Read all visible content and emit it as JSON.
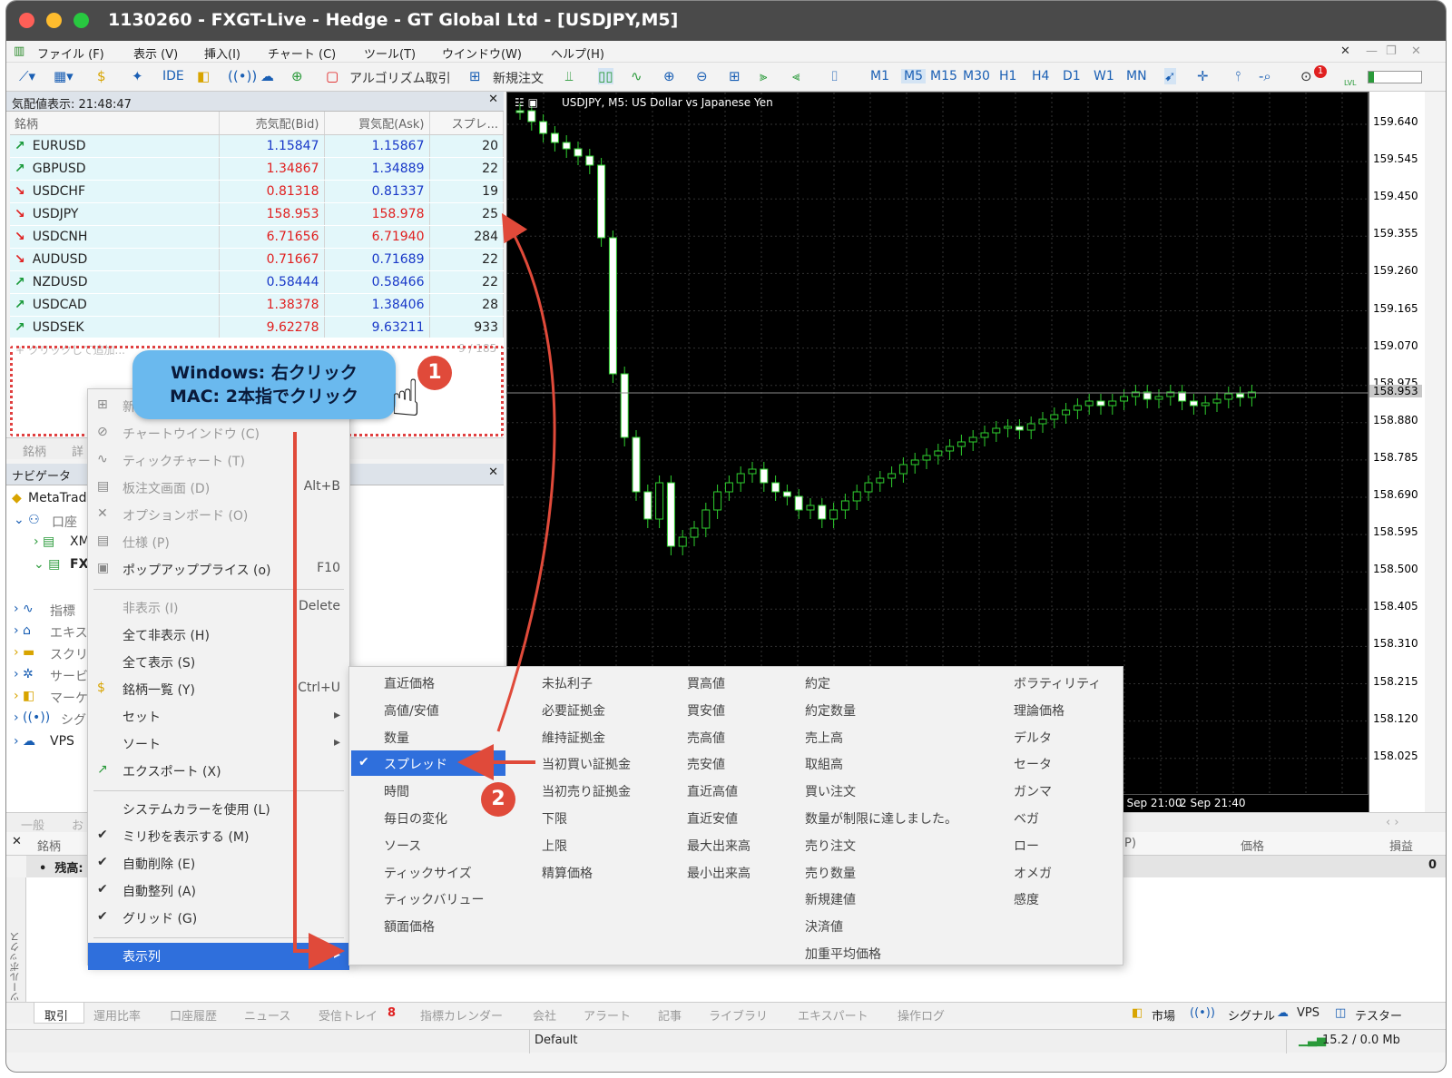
{
  "window": {
    "title": "1130260 - FXGT-Live - Hedge - GT Global Ltd - [USDJPY,M5]"
  },
  "menu": [
    "ファイル (F)",
    "表示 (V)",
    "挿入(I)",
    "チャート (C)",
    "ツール(T)",
    "ウインドウ(W)",
    "ヘルプ(H)"
  ],
  "toolbar": {
    "ide": "IDE",
    "algo": "アルゴリズム取引",
    "neworder": "新規注文",
    "timeframes": [
      "M1",
      "M5",
      "M15",
      "M30",
      "H1",
      "H4",
      "D1",
      "W1",
      "MN"
    ],
    "notif_count": "1",
    "lvl": "LVL"
  },
  "market_watch": {
    "title": "気配値表示: 21:48:47",
    "columns": [
      "銘柄",
      "売気配(Bid)",
      "買気配(Ask)",
      "スプレ..."
    ],
    "rows": [
      {
        "symbol": "EURUSD",
        "bid": "1.15847",
        "ask": "1.15867",
        "spread": "20",
        "dir": "up",
        "bidc": "blue",
        "askc": "blue"
      },
      {
        "symbol": "GBPUSD",
        "bid": "1.34867",
        "ask": "1.34889",
        "spread": "22",
        "dir": "up",
        "bidc": "red",
        "askc": "blue"
      },
      {
        "symbol": "USDCHF",
        "bid": "0.81318",
        "ask": "0.81337",
        "spread": "19",
        "dir": "down",
        "bidc": "red",
        "askc": "blue"
      },
      {
        "symbol": "USDJPY",
        "bid": "158.953",
        "ask": "158.978",
        "spread": "25",
        "dir": "down",
        "bidc": "red",
        "askc": "red"
      },
      {
        "symbol": "USDCNH",
        "bid": "6.71656",
        "ask": "6.71940",
        "spread": "284",
        "dir": "down",
        "bidc": "red",
        "askc": "red"
      },
      {
        "symbol": "AUDUSD",
        "bid": "0.71667",
        "ask": "0.71689",
        "spread": "22",
        "dir": "down",
        "bidc": "red",
        "askc": "blue"
      },
      {
        "symbol": "NZDUSD",
        "bid": "0.58444",
        "ask": "0.58466",
        "spread": "22",
        "dir": "up",
        "bidc": "blue",
        "askc": "blue"
      },
      {
        "symbol": "USDCAD",
        "bid": "1.38378",
        "ask": "1.38406",
        "spread": "28",
        "dir": "up",
        "bidc": "red",
        "askc": "blue"
      },
      {
        "symbol": "USDSEK",
        "bid": "9.62278",
        "ask": "9.63211",
        "spread": "933",
        "dir": "up",
        "bidc": "red",
        "askc": "blue"
      }
    ],
    "add_hint": "+ クリックして追加...",
    "count": "9 / 185",
    "tabs": [
      "銘柄",
      "詳"
    ]
  },
  "callout": {
    "line1": "Windows: 右クリック",
    "line2": "MAC: 2本指でクリック",
    "step1": "1",
    "step2": "2"
  },
  "navigator": {
    "title": "ナビゲータ",
    "items": [
      "MetaTrade",
      "口座",
      "XM",
      "FX",
      "指標",
      "エキス",
      "スクリ",
      "サービ",
      "マーケ",
      "シグナ",
      "VPS"
    ]
  },
  "context_menu": [
    {
      "label": "新",
      "shortcut": "",
      "dim": true
    },
    {
      "label": "チャートウインドウ (C)",
      "shortcut": "",
      "dim": true
    },
    {
      "label": "ティックチャート (T)",
      "shortcut": "",
      "dim": true
    },
    {
      "label": "板注文画面 (D)",
      "shortcut": "Alt+B",
      "dim": true
    },
    {
      "label": "オプションボード (O)",
      "shortcut": "",
      "dim": true
    },
    {
      "label": "仕様 (P)",
      "shortcut": "",
      "dim": true
    },
    {
      "label": "ポップアッププライス (o)",
      "shortcut": "F10",
      "dim": false
    },
    {
      "label": "非表示 (I)",
      "shortcut": "Delete",
      "dim": true
    },
    {
      "label": "全て非表示 (H)",
      "shortcut": "",
      "dim": false
    },
    {
      "label": "全て表示 (S)",
      "shortcut": "",
      "dim": false
    },
    {
      "label": "銘柄一覧 (Y)",
      "shortcut": "Ctrl+U",
      "dim": false
    },
    {
      "label": "セット",
      "shortcut": "▸",
      "dim": false
    },
    {
      "label": "ソート",
      "shortcut": "▸",
      "dim": false
    },
    {
      "label": "エクスポート (X)",
      "shortcut": "",
      "dim": false
    },
    {
      "label": "システムカラーを使用 (L)",
      "shortcut": "",
      "dim": false
    },
    {
      "label": "ミリ秒を表示する (M)",
      "shortcut": "",
      "dim": false
    },
    {
      "label": "自動削除 (E)",
      "shortcut": "",
      "dim": false
    },
    {
      "label": "自動整列 (A)",
      "shortcut": "",
      "dim": false
    },
    {
      "label": "グリッド (G)",
      "shortcut": "",
      "dim": false
    },
    {
      "label": "表示列",
      "shortcut": "▸",
      "dim": false
    }
  ],
  "submenu": {
    "col1": [
      "直近価格",
      "高値/安値",
      "数量",
      "スプレッド",
      "時間",
      "毎日の変化",
      "ソース",
      "ティックサイズ",
      "ティックバリュー",
      "額面価格"
    ],
    "col2": [
      "未払利子",
      "必要証拠金",
      "維持証拠金",
      "当初買い証拠金",
      "当初売り証拠金",
      "下限",
      "上限",
      "精算価格"
    ],
    "col3": [
      "買高値",
      "買安値",
      "売高値",
      "売安値",
      "直近高値",
      "直近安値",
      "最大出来高",
      "最小出来高"
    ],
    "col4": [
      "約定",
      "約定数量",
      "売上高",
      "取組高",
      "買い注文",
      "数量が制限に達しました。",
      "売り注文",
      "売り数量",
      "新規建値",
      "決済値",
      "加重平均価格"
    ],
    "col5": [
      "ボラティリティ",
      "理論価格",
      "デルタ",
      "セータ",
      "ガンマ",
      "ベガ",
      "ロー",
      "オメガ",
      "感度"
    ]
  },
  "chart": {
    "label": "USDJPY, M5:  US Dollar vs Japanese Yen",
    "price_labels": [
      "159.640",
      "159.545",
      "159.450",
      "159.355",
      "159.260",
      "159.165",
      "159.070",
      "158.975",
      "158.880",
      "158.785",
      "158.690",
      "158.595",
      "158.500",
      "158.405",
      "158.310",
      "158.215",
      "158.120",
      "158.025"
    ],
    "current_price": "158.953",
    "time_labels": [
      "2 Sep 21:00",
      "2 Sep 21:40"
    ]
  },
  "toolbox": {
    "tabs": [
      "一般",
      "お"
    ],
    "columns": [
      "銘柄",
      "価格",
      "損益"
    ],
    "balance_label": "残高:",
    "balance_value": "0",
    "side_label": "ツールボックス",
    "col_p": "P)"
  },
  "bottom_tabs": [
    "取引",
    "運用比率",
    "口座履歴",
    "ニュース",
    "受信トレイ",
    "指標カレンダー",
    "会社",
    "アラート",
    "記事",
    "ライブラリ",
    "エキスパート",
    "操作ログ"
  ],
  "inbox_count": "8",
  "bottom_right": [
    "市場",
    "シグナル",
    "VPS",
    "テスター"
  ],
  "status": {
    "profile": "Default",
    "traffic": "15.2 / 0.0 Mb"
  }
}
